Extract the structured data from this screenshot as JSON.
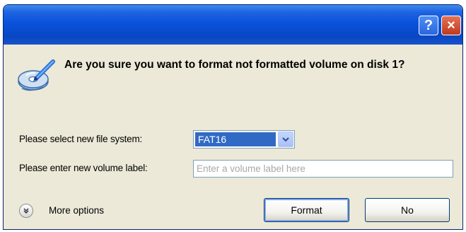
{
  "titlebar": {
    "help_label": "?",
    "close_label": "×"
  },
  "dialog": {
    "question": "Are you sure you want to format not formatted volume on disk 1?",
    "icon": "format-disk-icon"
  },
  "form": {
    "filesystem_label": "Please select new file system:",
    "filesystem_value": "FAT16",
    "volume_label": "Please enter new volume label:",
    "volume_placeholder": "Enter a volume label here",
    "volume_value": ""
  },
  "footer": {
    "more_options_label": "More options",
    "format_label": "Format",
    "no_label": "No"
  },
  "colors": {
    "titlebar": "#0a52dc",
    "dialog_bg": "#ece9d8",
    "selection": "#316ac5",
    "close_button": "#c0391b"
  }
}
